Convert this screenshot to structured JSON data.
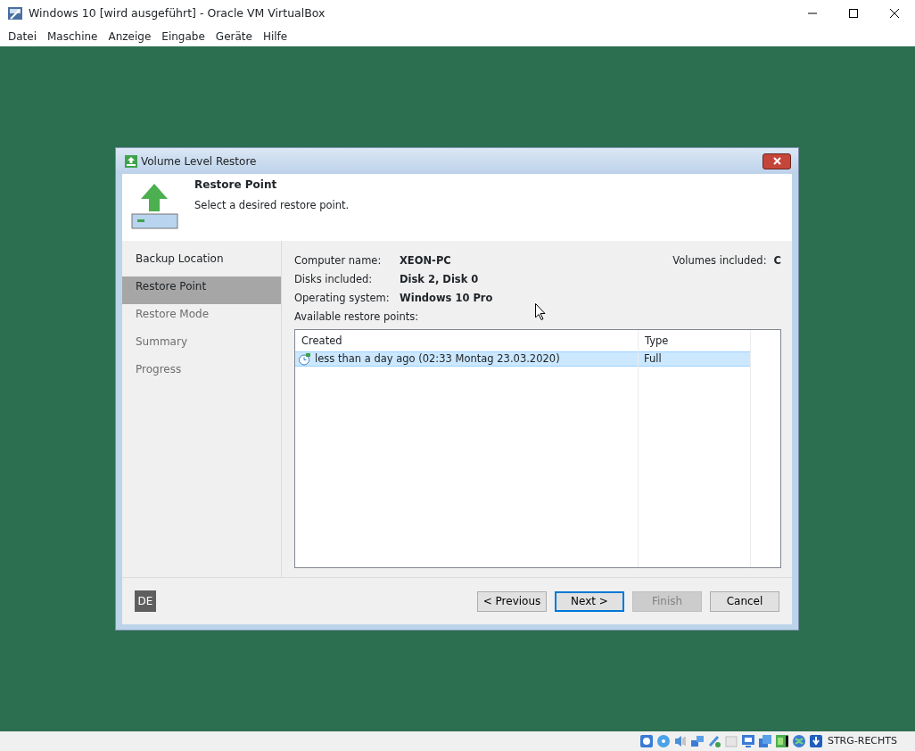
{
  "window": {
    "title": "Windows 10 [wird ausgeführt] - Oracle VM VirtualBox"
  },
  "menu": [
    "Datei",
    "Maschine",
    "Anzeige",
    "Eingabe",
    "Geräte",
    "Hilfe"
  ],
  "dialog": {
    "title": "Volume Level Restore",
    "header_title": "Restore Point",
    "header_subtitle": "Select a desired restore point.",
    "steps": [
      {
        "label": "Backup Location",
        "selected": false,
        "disabled": false
      },
      {
        "label": "Restore Point",
        "selected": true,
        "disabled": false
      },
      {
        "label": "Restore Mode",
        "selected": false,
        "disabled": true
      },
      {
        "label": "Summary",
        "selected": false,
        "disabled": true
      },
      {
        "label": "Progress",
        "selected": false,
        "disabled": true
      }
    ],
    "info": [
      {
        "label": "Computer name:",
        "value": "XEON-PC"
      },
      {
        "label": "Disks included:",
        "value": "Disk 2, Disk 0"
      },
      {
        "label": "Operating system:",
        "value": "Windows 10 Pro"
      }
    ],
    "volumes": {
      "label": "Volumes included:",
      "value": "C"
    },
    "list_label": "Available restore points:",
    "table": {
      "columns": [
        "Created",
        "Type"
      ],
      "rows": [
        {
          "cells": [
            "less than a day ago (02:33 Montag 23.03.2020)",
            "Full"
          ],
          "selected": true
        }
      ]
    },
    "language": "DE",
    "buttons": [
      {
        "label": "< Previous",
        "disabled": false,
        "default": false
      },
      {
        "label": "Next >",
        "disabled": false,
        "default": true
      },
      {
        "label": "Finish",
        "disabled": true,
        "default": false
      },
      {
        "label": "Cancel",
        "disabled": false,
        "default": false
      }
    ]
  },
  "status_bar": {
    "host_key": "STRG-RECHTS"
  }
}
